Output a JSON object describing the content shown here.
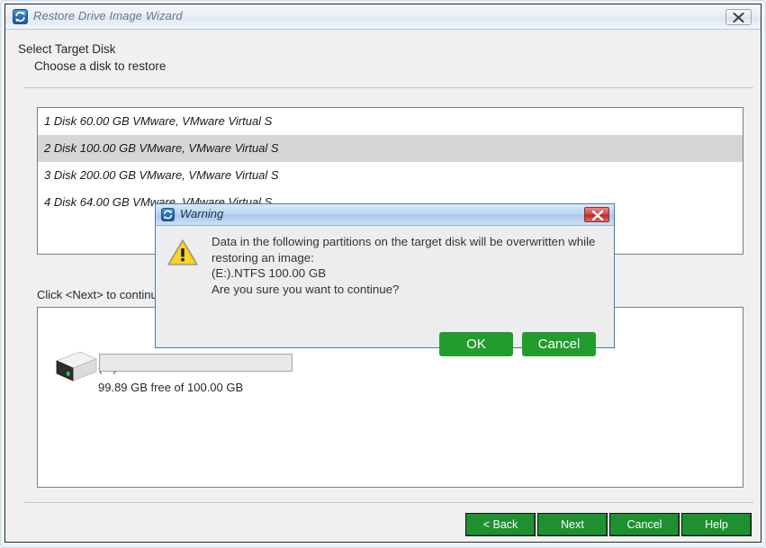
{
  "window": {
    "title": "Restore Drive Image Wizard",
    "icon": "restore-circular-arrows-icon",
    "close_label": "close-icon"
  },
  "header": {
    "title": "Select Target Disk",
    "subtitle": "Choose a disk to restore"
  },
  "disk_list": {
    "items": [
      {
        "label": "1 Disk 60.00 GB VMware,  VMware Virtual S",
        "selected": false
      },
      {
        "label": "2 Disk 100.00 GB VMware,  VMware Virtual S",
        "selected": true
      },
      {
        "label": "3 Disk 200.00 GB VMware,  VMware Virtual S",
        "selected": false
      },
      {
        "label": "4 Disk 64.00 GB VMware,  VMware Virtual S",
        "selected": false
      }
    ]
  },
  "instruction": "Click <Next> to continue",
  "partition_panel": {
    "partitions": [
      {
        "label": "(E:).NTFS",
        "free_text": "99.89 GB free of 100.00 GB",
        "used_percent": 0.11,
        "icon": "hard-drive-icon"
      }
    ]
  },
  "footer": {
    "buttons": [
      {
        "label": "< Back",
        "name": "back-button"
      },
      {
        "label": "Next",
        "name": "next-button"
      },
      {
        "label": "Cancel",
        "name": "cancel-button"
      },
      {
        "label": "Help",
        "name": "help-button"
      }
    ]
  },
  "dialog": {
    "title": "Warning",
    "icon": "restore-circular-arrows-icon",
    "warning_icon": "warning-triangle-icon",
    "close_label": "close-icon",
    "message_lines": [
      "Data in the following partitions on the target disk will be overwritten while",
      "restoring an image:",
      "(E:).NTFS 100.00 GB",
      "Are you sure you want to continue?"
    ],
    "buttons": [
      {
        "label": "OK",
        "name": "dialog-ok-button"
      },
      {
        "label": "Cancel",
        "name": "dialog-cancel-button"
      }
    ]
  },
  "colors": {
    "accent_green": "#239c2e",
    "footer_green": "#1e9030",
    "selection_gray": "#d6d6d6",
    "dialog_border_blue": "#3c7fb1",
    "close_red": "#cf4c4c",
    "warning_yellow": "#ffcc00"
  }
}
